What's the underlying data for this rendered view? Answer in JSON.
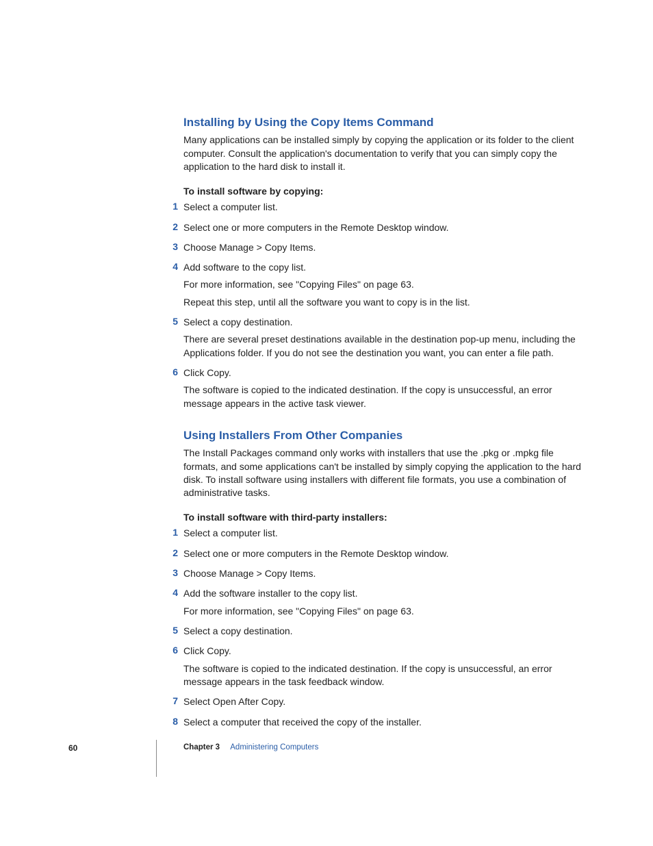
{
  "section1": {
    "heading": "Installing by Using the Copy Items Command",
    "intro": "Many applications can be installed simply by copying the application or its folder to the client computer. Consult the application's documentation to verify that you can simply copy the application to the hard disk to install it.",
    "subhead": "To install software by copying:",
    "steps": [
      {
        "n": "1",
        "lines": [
          "Select a computer list."
        ]
      },
      {
        "n": "2",
        "lines": [
          "Select one or more computers in the Remote Desktop window."
        ]
      },
      {
        "n": "3",
        "lines": [
          "Choose Manage > Copy Items."
        ]
      },
      {
        "n": "4",
        "lines": [
          "Add software to the copy list.",
          "For more information, see \"Copying Files\" on page 63.",
          "Repeat this step, until all the software you want to copy is in the list."
        ]
      },
      {
        "n": "5",
        "lines": [
          "Select a copy destination.",
          "There are several preset destinations available in the destination pop-up menu, including the Applications folder. If you do not see the destination you want, you can enter a file path."
        ]
      },
      {
        "n": "6",
        "lines": [
          "Click Copy.",
          "The software is copied to the indicated destination. If the copy is unsuccessful, an error message appears in the active task viewer."
        ]
      }
    ]
  },
  "section2": {
    "heading": "Using Installers From Other Companies",
    "intro": "The Install Packages command only works with installers that use the .pkg or .mpkg file formats, and some applications can't be installed by simply copying the application to the hard disk. To install software using installers with different file formats, you use a combination of administrative tasks.",
    "subhead": "To install software with third-party installers:",
    "steps": [
      {
        "n": "1",
        "lines": [
          "Select a computer list."
        ]
      },
      {
        "n": "2",
        "lines": [
          "Select one or more computers in the Remote Desktop window."
        ]
      },
      {
        "n": "3",
        "lines": [
          "Choose Manage > Copy Items."
        ]
      },
      {
        "n": "4",
        "lines": [
          "Add the software installer to the copy list.",
          "For more information, see \"Copying Files\" on page 63."
        ]
      },
      {
        "n": "5",
        "lines": [
          "Select a copy destination."
        ]
      },
      {
        "n": "6",
        "lines": [
          "Click Copy.",
          "The software is copied to the indicated destination. If the copy is unsuccessful, an error message appears in the task feedback window."
        ]
      },
      {
        "n": "7",
        "lines": [
          "Select Open After Copy."
        ]
      },
      {
        "n": "8",
        "lines": [
          "Select a computer that received the copy of the installer."
        ]
      }
    ]
  },
  "footer": {
    "page_number": "60",
    "chapter_label": "Chapter 3",
    "chapter_title": "Administering Computers"
  }
}
